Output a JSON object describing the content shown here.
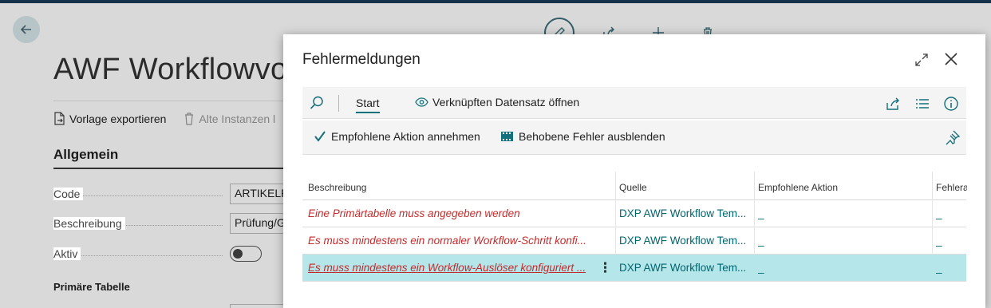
{
  "background_page": {
    "title": "AWF Workflowvo",
    "toolbar": {
      "export_label": "Vorlage exportieren",
      "delete_instances_label": "Alte Instanzen l"
    },
    "section_title": "Allgemein",
    "fields": {
      "code_label": "Code",
      "code_value": "ARTIKELPF",
      "description_label": "Beschreibung",
      "description_value": "Prüfung/G",
      "active_label": "Aktiv"
    },
    "primary_table_label": "Primäre Tabelle"
  },
  "dialog": {
    "title": "Fehlermeldungen",
    "actionbar": {
      "start_label": "Start",
      "open_record_label": "Verknüpften Datensatz öffnen"
    },
    "actionbar2": {
      "accept_label": "Empfohlene Aktion annehmen",
      "hide_fixed_label": "Behobene Fehler ausblenden"
    },
    "table": {
      "columns": [
        "Beschreibung",
        "Quelle",
        "Empfohlene Aktion",
        "Fehlerau"
      ],
      "rows": [
        {
          "description": "Eine Primärtabelle muss angegeben werden",
          "source": "DXP AWF Workflow Tem...",
          "action": "_",
          "error": "_"
        },
        {
          "description": "Es muss mindestens ein normaler Workflow-Schritt konfi...",
          "source": "DXP AWF Workflow Tem...",
          "action": "_",
          "error": "_"
        },
        {
          "description": "Es muss mindestens ein Workflow-Auslöser konfiguriert ...",
          "source": "DXP AWF Workflow Tem...",
          "action": "_",
          "error": "_"
        }
      ],
      "selected_row": 2,
      "kebab_symbol": "⋮"
    }
  },
  "colors": {
    "accent": "#00707a",
    "error_text": "#c32b2b",
    "selected_row": "#b5e6ea"
  }
}
